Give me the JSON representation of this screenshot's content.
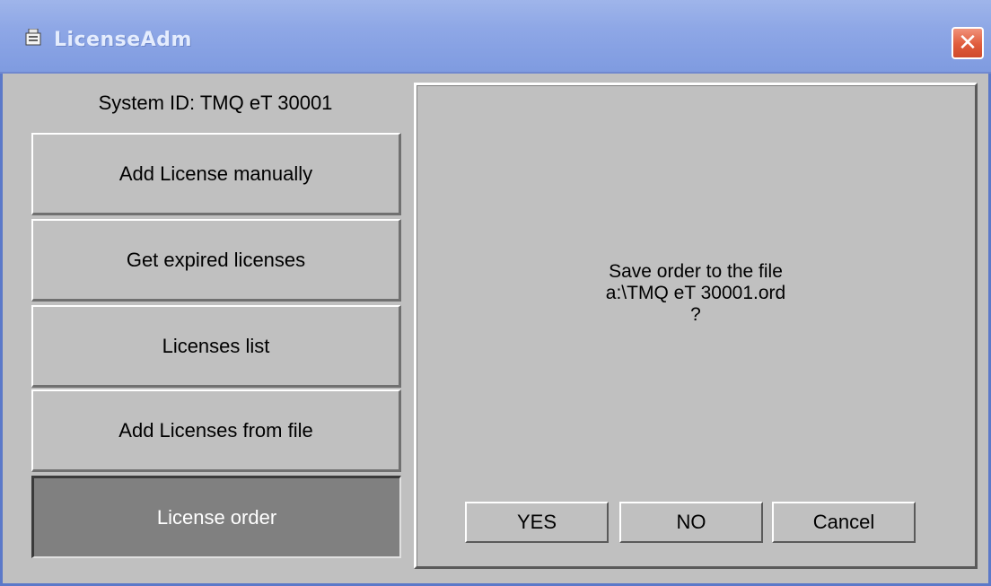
{
  "window": {
    "title": "LicenseAdm",
    "close_glyph": "✕",
    "app_icon": "license-app-icon",
    "colors": {
      "titlebar": "#8ea7e6",
      "face": "#c0c0c0",
      "active_button": "#808080",
      "close_button": "#e05c3c"
    }
  },
  "left": {
    "system_id": "System ID: TMQ eT 30001",
    "buttons": [
      {
        "label": "Add License manually",
        "active": false
      },
      {
        "label": "Get expired licenses",
        "active": false
      },
      {
        "label": "Licenses list",
        "active": false
      },
      {
        "label": "Add Licenses from file",
        "active": false
      },
      {
        "label": "License order",
        "active": true
      }
    ]
  },
  "dialog": {
    "message": [
      "Save order to the file",
      "a:\\TMQ eT 30001.ord",
      "?"
    ],
    "buttons": {
      "yes": "YES",
      "no": "NO",
      "cancel": "Cancel"
    }
  }
}
